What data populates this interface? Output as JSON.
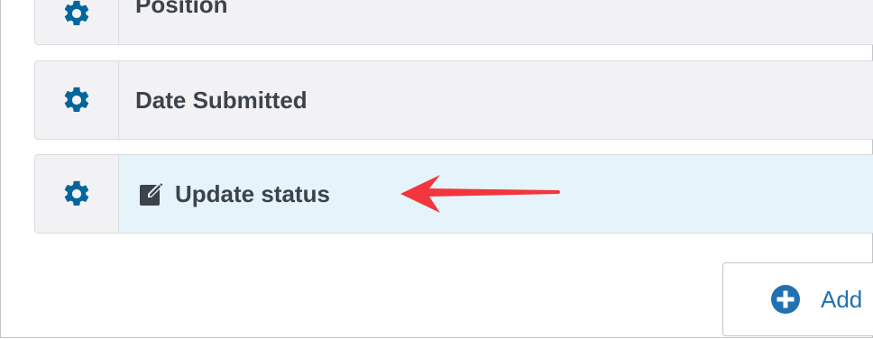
{
  "fields": [
    {
      "label": "Position",
      "icon": "gear-icon"
    },
    {
      "label": "Date Submitted",
      "icon": "gear-icon"
    },
    {
      "label": "Update status",
      "icon": "gear-icon",
      "label_icon": "edit-icon",
      "highlighted": true
    }
  ],
  "add_button": {
    "label": "Add",
    "icon": "plus-circle-icon"
  },
  "colors": {
    "gear": "#00669b",
    "highlight_bg": "#e5f3fa",
    "row_bg": "#f2f2f4",
    "arrow": "#f2363c",
    "link": "#2271b1",
    "text": "#3c434a"
  }
}
